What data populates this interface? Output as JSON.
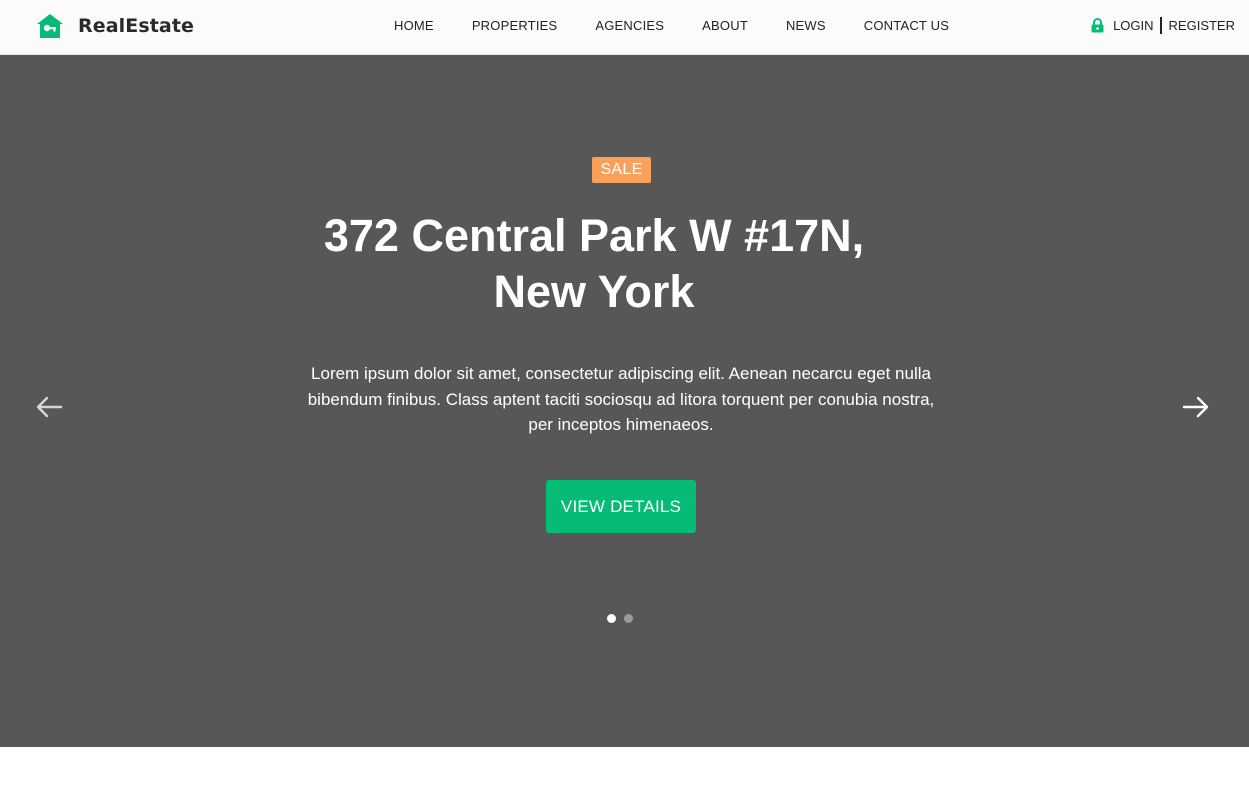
{
  "brand": {
    "name": "RealEstate",
    "icon": "house-key-icon"
  },
  "nav": {
    "items": [
      "HOME",
      "PROPERTIES",
      "AGENCIES",
      "ABOUT",
      "NEWS",
      "CONTACT US"
    ]
  },
  "auth": {
    "icon": "lock-icon",
    "login_label": "LOGIN",
    "register_label": "REGISTER"
  },
  "hero": {
    "badge": "SALE",
    "title_line1": "372 Central Park W #17N,",
    "title_line2": "New York",
    "description": "Lorem ipsum dolor sit amet, consectetur adipiscing elit. Aenean necarcu eget nulla bibendum finibus. Class aptent taciti sociosqu ad litora torquent per conubia nostra, per inceptos himenaeos.",
    "cta_label": "VIEW DETAILS",
    "prev_icon": "arrow-left-icon",
    "next_icon": "arrow-right-icon",
    "slides_total": 2,
    "active_slide": 1
  },
  "colors": {
    "accent": "#05bb75",
    "badge": "#f9a05a",
    "hero_background": "#575757",
    "header_background": "#fbfbfb"
  }
}
